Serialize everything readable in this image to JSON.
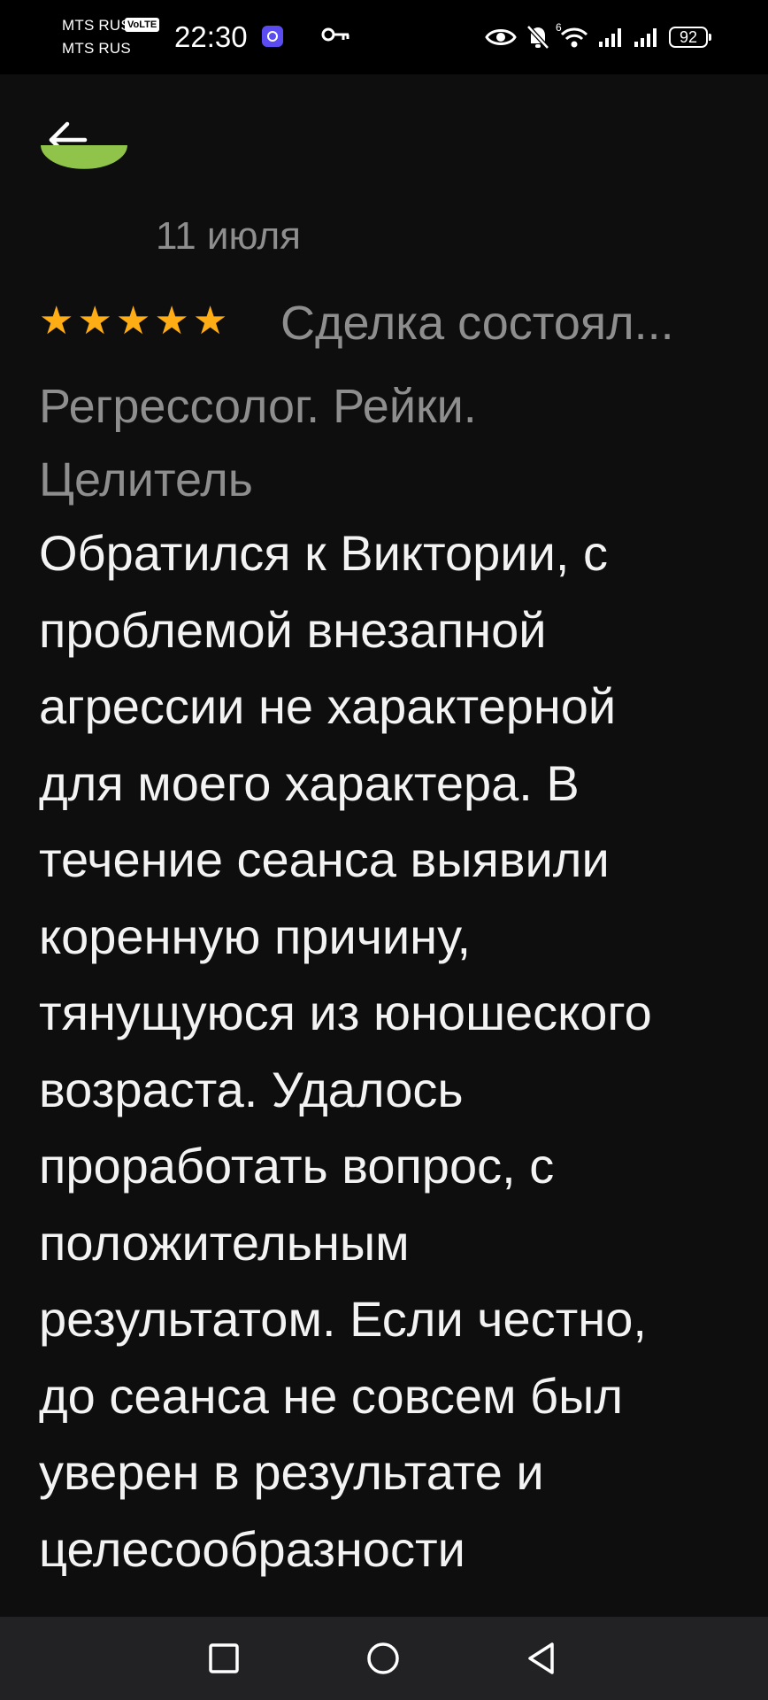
{
  "status_bar": {
    "carrier_1": "MTS RUS",
    "carrier_2": "MTS RUS",
    "volte": "VoLTE",
    "time": "22:30",
    "wifi_label": "6",
    "battery": "92",
    "icons": [
      "app-notification-icon",
      "key-icon",
      "eye-icon",
      "bell-muted-icon",
      "wifi-icon",
      "signal-icon",
      "signal-icon",
      "battery-icon"
    ]
  },
  "header": {
    "back_icon": "arrow-left-icon"
  },
  "review": {
    "date": "11 июля",
    "rating": 5,
    "stars": [
      "★",
      "★",
      "★",
      "★",
      "★"
    ],
    "deal_status": "Сделка состоял...",
    "service_lines": [
      "Регрессолог. Рейки.",
      "Целитель"
    ],
    "text_lines": [
      "Обратился к Виктории, с",
      "проблемой внезапной",
      "агрессии не характерной",
      "для моего характера. В",
      "течение сеанса выявили",
      "коренную причину,",
      "тянущуюся из юношеского",
      "возраста. Удалось",
      "проработать вопрос, с",
      "положительным",
      "результатом. Если честно,",
      "до сеанса не совсем был",
      "уверен в результате и",
      "целесообразности"
    ],
    "colors": {
      "star": "#ffad15",
      "avatar": "#8fc34a",
      "muted_text": "#8e8e8e",
      "background": "#0e0e0e"
    }
  },
  "nav_bar": {
    "buttons": [
      "square-recents-icon",
      "circle-home-icon",
      "triangle-back-icon"
    ]
  }
}
